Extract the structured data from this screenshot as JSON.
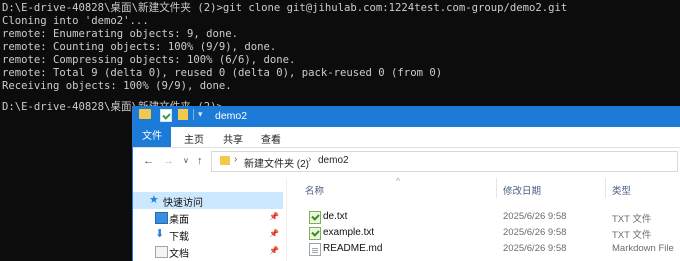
{
  "console": {
    "lines": [
      "D:\\E-drive-40828\\桌面\\新建文件夹 (2)>git clone git@jihulab.com:1224test.com-group/demo2.git",
      "Cloning into 'demo2'...",
      "remote: Enumerating objects: 9, done.",
      "remote: Counting objects: 100% (9/9), done.",
      "remote: Compressing objects: 100% (6/6), done.",
      "remote: Total 9 (delta 0), reused 0 (delta 0), pack-reused 0 (from 0)",
      "Receiving objects: 100% (9/9), done.",
      "",
      "D:\\E-drive-40828\\桌面\\新建文件夹 (2)>"
    ]
  },
  "explorer": {
    "title": "demo2",
    "quick_access_toolbar": {
      "folder_icon": "folder-icon",
      "properties_icon": "properties-check-icon",
      "new_folder_icon": "new-folder-icon",
      "dropdown_glyph": "▾"
    },
    "ribbon": {
      "tabs": [
        "文件",
        "主页",
        "共享",
        "查看"
      ]
    },
    "navigation": {
      "back": "←",
      "forward": "→",
      "recent_dropdown": "∨",
      "up": "↑"
    },
    "address": {
      "crumbs": [
        "新建文件夹 (2)",
        "demo2"
      ],
      "separator": "›"
    },
    "nav_pane": {
      "items": [
        {
          "label": "快速访问",
          "icon": "star-icon",
          "pinned": false
        },
        {
          "label": "桌面",
          "icon": "desktop-icon",
          "pinned": true
        },
        {
          "label": "下载",
          "icon": "download-icon",
          "pinned": true
        },
        {
          "label": "文档",
          "icon": "documents-icon",
          "pinned": true
        }
      ]
    },
    "columns": {
      "name": "名称",
      "date": "修改日期",
      "type": "类型",
      "sort_glyph": "^"
    },
    "files": [
      {
        "name": "de.txt",
        "date": "2025/6/26 9:58",
        "type": "TXT 文件",
        "icon": "txt-file-icon"
      },
      {
        "name": "example.txt",
        "date": "2025/6/26 9:58",
        "type": "TXT 文件",
        "icon": "txt-file-icon"
      },
      {
        "name": "README.md",
        "date": "2025/6/26 9:58",
        "type": "Markdown File",
        "icon": "markdown-file-icon"
      }
    ],
    "colors": {
      "accent": "#1b7bd6",
      "selection": "#cce8ff",
      "console_bg": "#0c0c0c",
      "console_fg": "#cccccc"
    }
  }
}
